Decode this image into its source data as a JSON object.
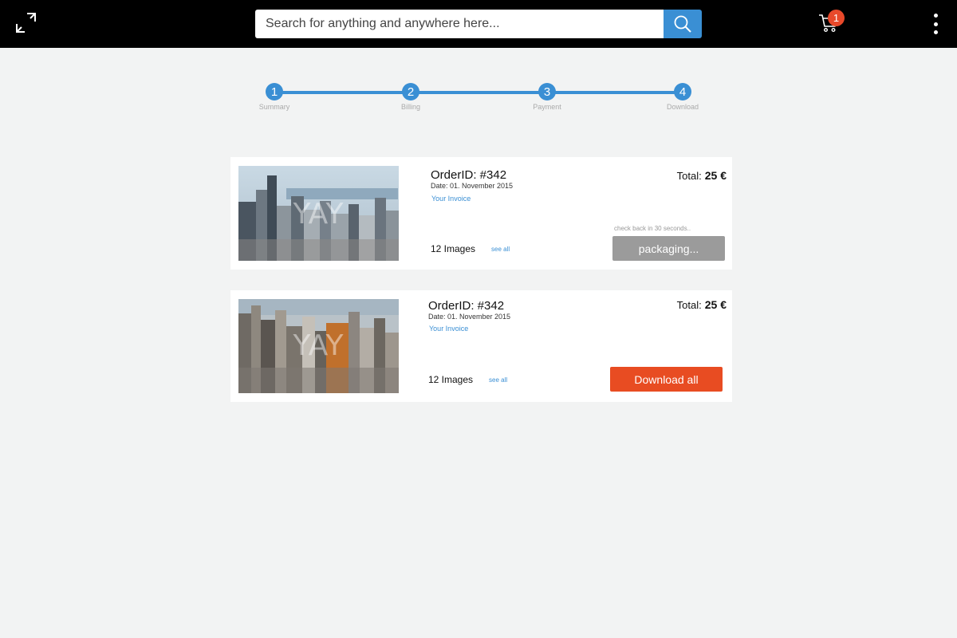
{
  "header": {
    "search_placeholder": "Search for anything and anywhere here...",
    "cart_count": "1"
  },
  "stepper": {
    "steps": [
      {
        "number": "1",
        "label": "Summary"
      },
      {
        "number": "2",
        "label": "Billing"
      },
      {
        "number": "3",
        "label": "Payment"
      },
      {
        "number": "4",
        "label": "Download"
      }
    ]
  },
  "orders": [
    {
      "order_id": "OrderID: #342",
      "date": "Date: 01. November 2015",
      "invoice_label": "Your Invoice",
      "total_label": "Total:",
      "total_value": "25 €",
      "image_count": "12 Images",
      "see_all": "see all",
      "status_hint": "check back in 30 seconds..",
      "action_label": "packaging...",
      "watermark": "YAY"
    },
    {
      "order_id": "OrderID: #342",
      "date": "Date: 01. November 2015",
      "invoice_label": "Your Invoice",
      "total_label": "Total:",
      "total_value": "25 €",
      "image_count": "12 Images",
      "see_all": "see all",
      "action_label": "Download all",
      "watermark": "YAY"
    }
  ],
  "colors": {
    "accent": "#3a8fd4",
    "badge": "#e8492a",
    "download_button": "#e84c22",
    "disabled_button": "#9b9b9b",
    "topbar": "#000000",
    "background": "#f2f3f3"
  },
  "icons": {
    "expand": "expand-icon",
    "search": "search-icon",
    "cart": "cart-icon",
    "more": "more-vertical-icon"
  }
}
